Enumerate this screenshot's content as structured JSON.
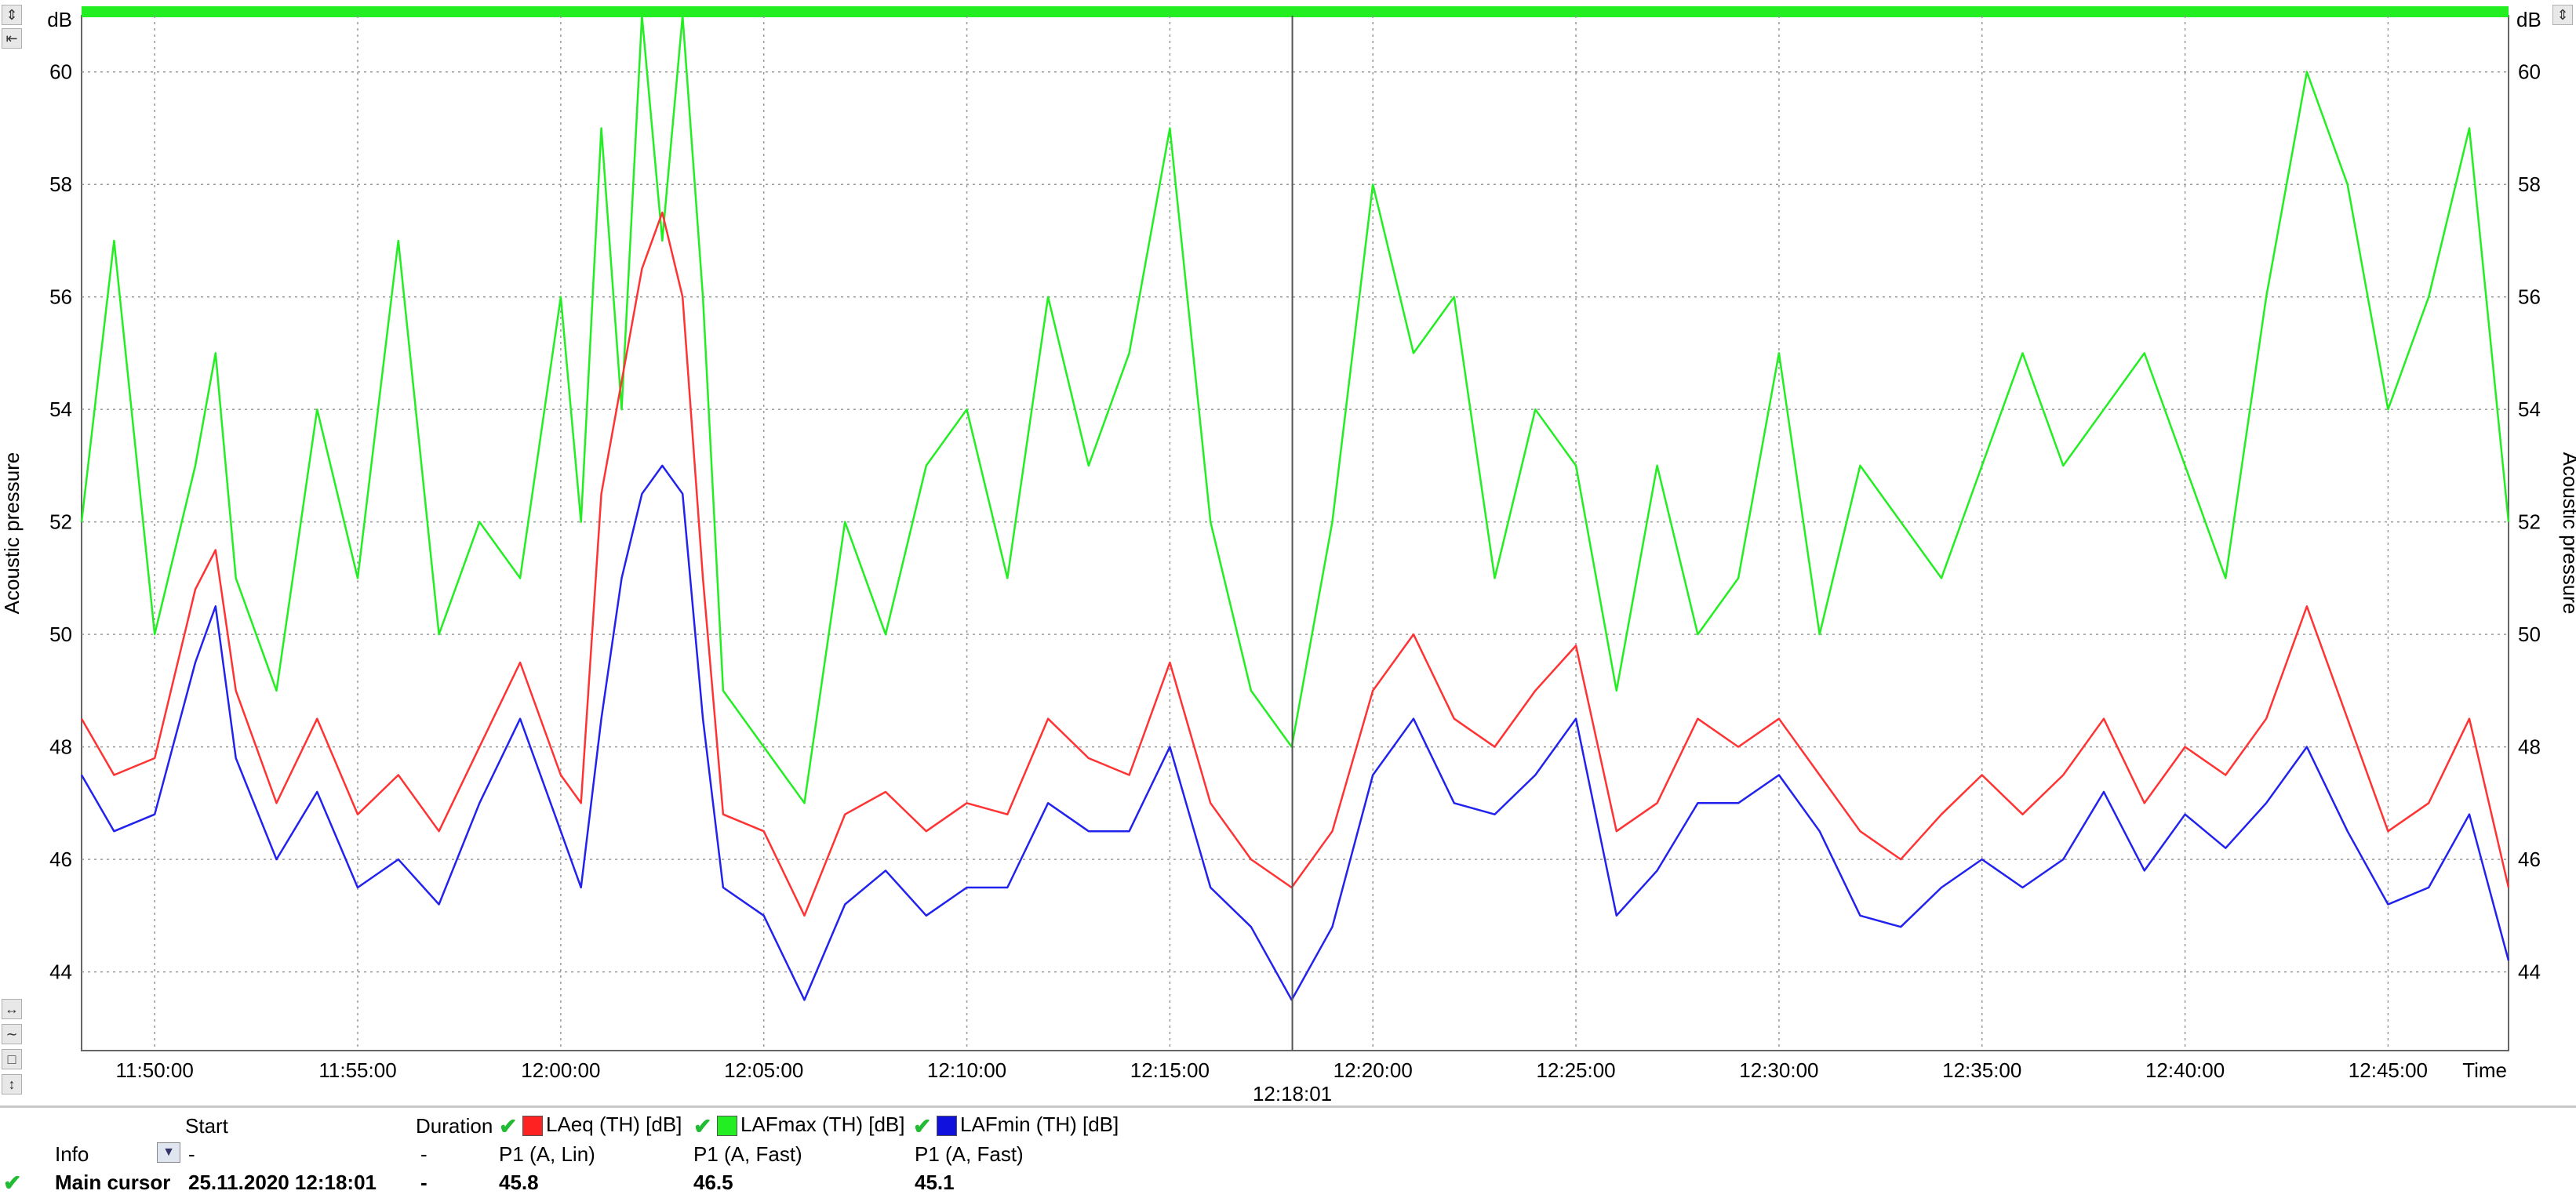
{
  "chart_data": {
    "type": "line",
    "ylabel_left": "Acoustic pressure",
    "ylabel_right": "Acoustic pressure",
    "unit": "dB",
    "xlabel": "Time",
    "ylim": [
      42.6,
      61.0
    ],
    "yticks": [
      44,
      46,
      48,
      50,
      52,
      54,
      56,
      58,
      60
    ],
    "xlim": [
      "11:48:12",
      "12:47:58"
    ],
    "xticks": [
      "11:50:00",
      "11:55:00",
      "12:00:00",
      "12:05:00",
      "12:10:00",
      "12:15:00",
      "12:20:00",
      "12:25:00",
      "12:30:00",
      "12:35:00",
      "12:40:00",
      "12:45:00"
    ],
    "grid": true,
    "cursor_time": "12:18:01",
    "series": [
      {
        "name": "LAFmax (TH) [dB]",
        "color": "#22ee22",
        "x": [
          "11:48:12",
          "11:49:00",
          "11:50:00",
          "11:51:00",
          "11:51:30",
          "11:52:00",
          "11:53:00",
          "11:54:00",
          "11:55:00",
          "11:56:00",
          "11:57:00",
          "11:58:00",
          "11:59:00",
          "12:00:00",
          "12:00:30",
          "12:01:00",
          "12:01:30",
          "12:02:00",
          "12:02:30",
          "12:03:00",
          "12:03:30",
          "12:04:00",
          "12:05:00",
          "12:06:00",
          "12:07:00",
          "12:08:00",
          "12:09:00",
          "12:10:00",
          "12:11:00",
          "12:12:00",
          "12:13:00",
          "12:14:00",
          "12:15:00",
          "12:16:00",
          "12:17:00",
          "12:18:00",
          "12:19:00",
          "12:20:00",
          "12:21:00",
          "12:22:00",
          "12:23:00",
          "12:24:00",
          "12:25:00",
          "12:26:00",
          "12:27:00",
          "12:28:00",
          "12:29:00",
          "12:30:00",
          "12:31:00",
          "12:32:00",
          "12:33:00",
          "12:34:00",
          "12:35:00",
          "12:36:00",
          "12:37:00",
          "12:38:00",
          "12:39:00",
          "12:40:00",
          "12:41:00",
          "12:42:00",
          "12:43:00",
          "12:44:00",
          "12:45:00",
          "12:46:00",
          "12:47:00",
          "12:47:58"
        ],
        "values": [
          52,
          57,
          50,
          53,
          55,
          51,
          49,
          54,
          51,
          57,
          50,
          52,
          51,
          56,
          52,
          59,
          54,
          61,
          57,
          62,
          56,
          49,
          48,
          47,
          52,
          50,
          53,
          54,
          51,
          56,
          53,
          55,
          59,
          52,
          49,
          48,
          52,
          58,
          55,
          56,
          51,
          54,
          53,
          49,
          53,
          50,
          51,
          55,
          50,
          53,
          52,
          51,
          53,
          55,
          53,
          54,
          55,
          53,
          51,
          56,
          60,
          58,
          54,
          56,
          59,
          52
        ]
      },
      {
        "name": "LAeq (TH) [dB]",
        "color": "#ff3333",
        "x": [
          "11:48:12",
          "11:49:00",
          "11:50:00",
          "11:51:00",
          "11:51:30",
          "11:52:00",
          "11:53:00",
          "11:54:00",
          "11:55:00",
          "11:56:00",
          "11:57:00",
          "11:58:00",
          "11:59:00",
          "12:00:00",
          "12:00:30",
          "12:01:00",
          "12:01:30",
          "12:02:00",
          "12:02:30",
          "12:03:00",
          "12:03:30",
          "12:04:00",
          "12:05:00",
          "12:06:00",
          "12:07:00",
          "12:08:00",
          "12:09:00",
          "12:10:00",
          "12:11:00",
          "12:12:00",
          "12:13:00",
          "12:14:00",
          "12:15:00",
          "12:16:00",
          "12:17:00",
          "12:18:00",
          "12:19:00",
          "12:20:00",
          "12:21:00",
          "12:22:00",
          "12:23:00",
          "12:24:00",
          "12:25:00",
          "12:26:00",
          "12:27:00",
          "12:28:00",
          "12:29:00",
          "12:30:00",
          "12:31:00",
          "12:32:00",
          "12:33:00",
          "12:34:00",
          "12:35:00",
          "12:36:00",
          "12:37:00",
          "12:38:00",
          "12:39:00",
          "12:40:00",
          "12:41:00",
          "12:42:00",
          "12:43:00",
          "12:44:00",
          "12:45:00",
          "12:46:00",
          "12:47:00",
          "12:47:58"
        ],
        "values": [
          48.5,
          47.5,
          47.8,
          50.8,
          51.5,
          49.0,
          47.0,
          48.5,
          46.8,
          47.5,
          46.5,
          48.0,
          49.5,
          47.5,
          47.0,
          52.5,
          54.5,
          56.5,
          57.5,
          56.0,
          51.0,
          46.8,
          46.5,
          45.0,
          46.8,
          47.2,
          46.5,
          47.0,
          46.8,
          48.5,
          47.8,
          47.5,
          49.5,
          47.0,
          46.0,
          45.5,
          46.5,
          49.0,
          50.0,
          48.5,
          48.0,
          49.0,
          49.8,
          46.5,
          47.0,
          48.5,
          48.0,
          48.5,
          47.5,
          46.5,
          46.0,
          46.8,
          47.5,
          46.8,
          47.5,
          48.5,
          47.0,
          48.0,
          47.5,
          48.5,
          50.5,
          48.5,
          46.5,
          47.0,
          48.5,
          45.5
        ]
      },
      {
        "name": "LAFmin (TH) [dB]",
        "color": "#2222ee",
        "x": [
          "11:48:12",
          "11:49:00",
          "11:50:00",
          "11:51:00",
          "11:51:30",
          "11:52:00",
          "11:53:00",
          "11:54:00",
          "11:55:00",
          "11:56:00",
          "11:57:00",
          "11:58:00",
          "11:59:00",
          "12:00:00",
          "12:00:30",
          "12:01:00",
          "12:01:30",
          "12:02:00",
          "12:02:30",
          "12:03:00",
          "12:03:30",
          "12:04:00",
          "12:05:00",
          "12:06:00",
          "12:07:00",
          "12:08:00",
          "12:09:00",
          "12:10:00",
          "12:11:00",
          "12:12:00",
          "12:13:00",
          "12:14:00",
          "12:15:00",
          "12:16:00",
          "12:17:00",
          "12:18:00",
          "12:19:00",
          "12:20:00",
          "12:21:00",
          "12:22:00",
          "12:23:00",
          "12:24:00",
          "12:25:00",
          "12:26:00",
          "12:27:00",
          "12:28:00",
          "12:29:00",
          "12:30:00",
          "12:31:00",
          "12:32:00",
          "12:33:00",
          "12:34:00",
          "12:35:00",
          "12:36:00",
          "12:37:00",
          "12:38:00",
          "12:39:00",
          "12:40:00",
          "12:41:00",
          "12:42:00",
          "12:43:00",
          "12:44:00",
          "12:45:00",
          "12:46:00",
          "12:47:00",
          "12:47:58"
        ],
        "values": [
          47.5,
          46.5,
          46.8,
          49.5,
          50.5,
          47.8,
          46.0,
          47.2,
          45.5,
          46.0,
          45.2,
          47.0,
          48.5,
          46.5,
          45.5,
          48.5,
          51.0,
          52.5,
          53.0,
          52.5,
          48.5,
          45.5,
          45.0,
          43.5,
          45.2,
          45.8,
          45.0,
          45.5,
          45.5,
          47.0,
          46.5,
          46.5,
          48.0,
          45.5,
          44.8,
          43.5,
          44.8,
          47.5,
          48.5,
          47.0,
          46.8,
          47.5,
          48.5,
          45.0,
          45.8,
          47.0,
          47.0,
          47.5,
          46.5,
          45.0,
          44.8,
          45.5,
          46.0,
          45.5,
          46.0,
          47.2,
          45.8,
          46.8,
          46.2,
          47.0,
          48.0,
          46.5,
          45.2,
          45.5,
          46.8,
          44.2
        ]
      }
    ]
  },
  "table": {
    "headers": {
      "info": "Info",
      "start": "Start",
      "duration": "Duration",
      "laeq": "LAeq (TH) [dB]",
      "lafmax": "LAFmax (TH) [dB]",
      "lafmin": "LAFmin (TH) [dB]"
    },
    "subheaders": {
      "start": "-",
      "duration": "-",
      "laeq": "P1 (A, Lin)",
      "lafmax": "P1 (A, Fast)",
      "lafmin": "P1 (A, Fast)"
    },
    "row": {
      "label": "Main cursor",
      "start": "25.11.2020 12:18:01",
      "duration": "-",
      "laeq": "45.8",
      "lafmax": "46.5",
      "lafmin": "45.1"
    },
    "colors": {
      "laeq": "#ff2222",
      "lafmax": "#22ee22",
      "lafmin": "#1111dd"
    }
  },
  "icons": [
    "check-icon",
    "dropdown-arrow-icon",
    "zoom-fit-icon",
    "expand-icon",
    "pan-horizontal-icon",
    "wave-icon",
    "square-icon",
    "pan-vertical-icon"
  ]
}
